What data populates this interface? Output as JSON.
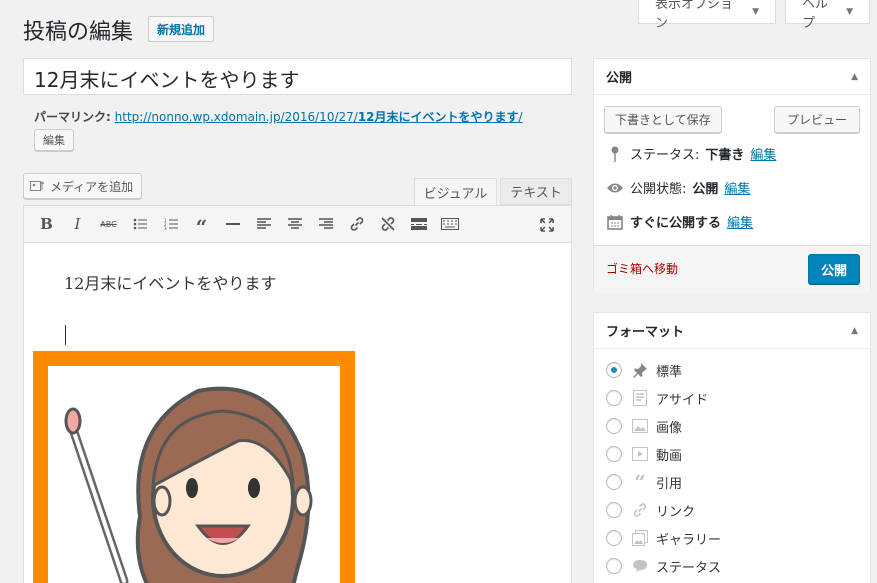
{
  "screen_options": {
    "label": "表示オプション",
    "help": "ヘルプ"
  },
  "header": {
    "title": "投稿の編集",
    "add_new": "新規追加"
  },
  "post": {
    "title": "12月末にイベントをやります",
    "permalink_label": "パーマリンク:",
    "permalink_base": "http://nonno.wp.xdomain.jp/2016/10/27/",
    "permalink_slug": "12月末にイベントをやります",
    "permalink_end": "/",
    "edit_slug": "編集",
    "body_text": "12月末にイベントをやります"
  },
  "media": {
    "add_media": "メディアを追加"
  },
  "editor_tabs": {
    "visual": "ビジュアル",
    "text": "テキスト"
  },
  "toolbar": [
    "bold-icon",
    "italic-icon",
    "strikethrough-icon",
    "bulleted-list-icon",
    "numbered-list-icon",
    "blockquote-icon",
    "horizontal-line-icon",
    "align-left-icon",
    "align-center-icon",
    "align-right-icon",
    "insert-link-icon",
    "remove-link-icon",
    "read-more-icon",
    "toolbar-toggle-icon",
    "fullscreen-icon"
  ],
  "publish_box": {
    "title": "公開",
    "save_draft": "下書きとして保存",
    "preview": "プレビュー",
    "status_label": "ステータス:",
    "status_value": "下書き",
    "status_edit": "編集",
    "visibility_label": "公開状態:",
    "visibility_value": "公開",
    "visibility_edit": "編集",
    "schedule_label": "すぐに公開する",
    "schedule_edit": "編集",
    "trash": "ゴミ箱へ移動",
    "publish": "公開"
  },
  "format_box": {
    "title": "フォーマット",
    "options": [
      {
        "label": "標準",
        "icon": "pushpin-icon",
        "selected": true
      },
      {
        "label": "アサイド",
        "icon": "aside-icon",
        "selected": false
      },
      {
        "label": "画像",
        "icon": "image-icon",
        "selected": false
      },
      {
        "label": "動画",
        "icon": "video-icon",
        "selected": false
      },
      {
        "label": "引用",
        "icon": "quote-icon",
        "selected": false
      },
      {
        "label": "リンク",
        "icon": "link-icon",
        "selected": false
      },
      {
        "label": "ギャラリー",
        "icon": "gallery-icon",
        "selected": false
      },
      {
        "label": "ステータス",
        "icon": "status-icon",
        "selected": false
      }
    ]
  },
  "colors": {
    "accent": "#0073aa",
    "publish": "#0085ba",
    "trash": "#aa0000",
    "image_frame": "#fb8c00"
  }
}
